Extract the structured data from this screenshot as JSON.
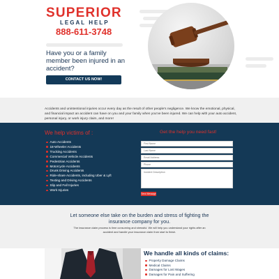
{
  "hero": {
    "brand": "SUPERIOR",
    "brand_sub": "LEGAL HELP",
    "phone": "888-611-3748",
    "headline": "Have you or a family member been injured in an accident?",
    "cta": "CONTACT US NOW!"
  },
  "intro": {
    "text": "Accidents and unintentional injuries occur every day as the result of other people's negligence. We know the emotional, physical, and financial impact an accident can have on you and your family when you've been injured. We can help with your auto accident, personal injury, or work injury claim, and more!"
  },
  "victims": {
    "title": "We help victims of :",
    "items": [
      "Auto Accidents",
      "18-Wheeler Accidents",
      "Trucking Accidents",
      "Commercial Vehicle Accidents",
      "Pedestrian Accidents",
      "Motorcycle Accidents",
      "Drunk Driving Accidents",
      "Ride-share Accidents, including Uber & Lyft",
      "Texting and Driving Accidents",
      "Slip and Fall Injuries",
      "Work Injuries"
    ]
  },
  "form": {
    "title": "Get the help you need fast!",
    "first_name_placeholder": "First Name",
    "last_name_placeholder": "Last Name",
    "email_placeholder": "Email Address",
    "phone_placeholder": "Phone",
    "description_placeholder": "Incident Description",
    "send_label": "Send Message"
  },
  "burden": {
    "title": "Let someone else take on the burden and stress of fighting the insurance company for you.",
    "text": "The insurance claim process is time consuming and stressful. We will help you understand your rights after an accident and handle your insurance claim from start to finish."
  },
  "claims": {
    "title": "We handle all kinds of claims:",
    "items": [
      "Property Damage Claims",
      "Medical Claims",
      "Damages for Lost Wages",
      "Damages for Pain and Suffering"
    ]
  },
  "colors": {
    "brand_red": "#e0312b",
    "navy": "#143956",
    "light_gray": "#f0f0f0"
  }
}
